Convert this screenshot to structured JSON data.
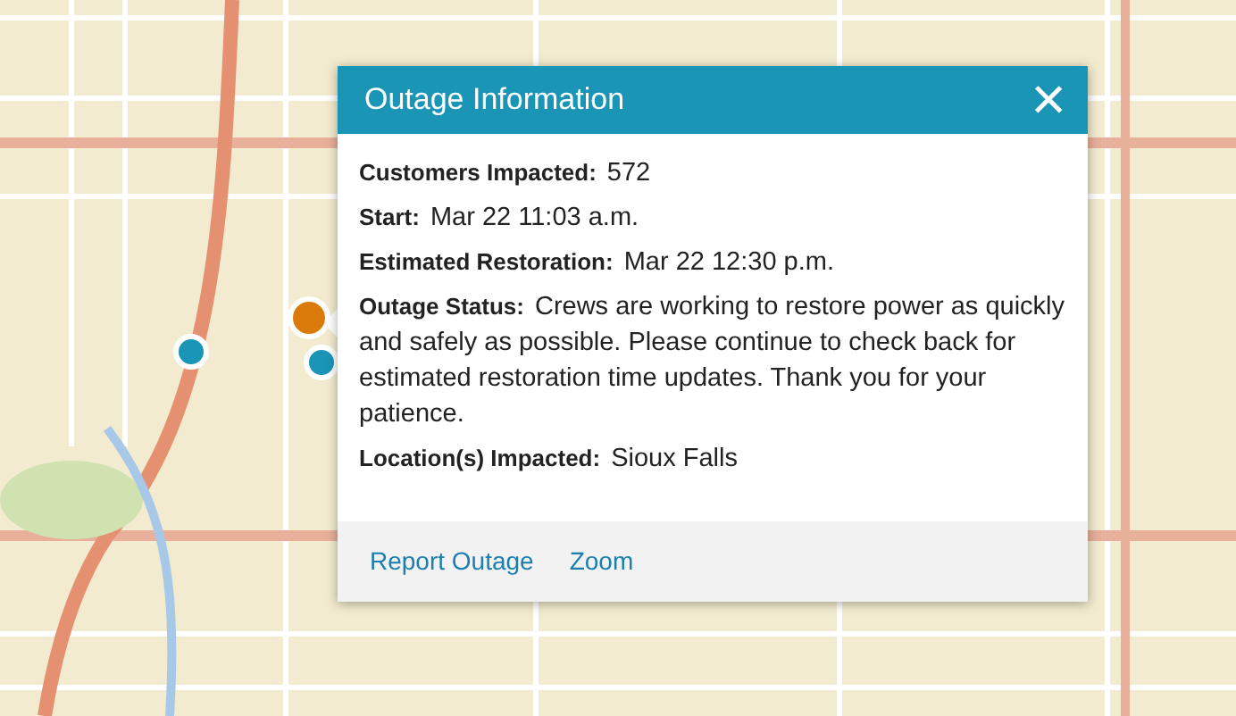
{
  "map": {
    "markers": [
      {
        "color": "#d97a0a"
      },
      {
        "color": "#1a95b8"
      },
      {
        "color": "#1a95b8"
      }
    ]
  },
  "popup": {
    "title": "Outage Information",
    "close": "×",
    "fields": [
      {
        "label": "Customers Impacted:",
        "value": "572"
      },
      {
        "label": "Start:",
        "value": "Mar 22 11:03 a.m."
      },
      {
        "label": "Estimated Restoration:",
        "value": "Mar 22 12:30 p.m."
      },
      {
        "label": "Outage Status:",
        "value": "Crews are working to restore power as quickly and safely as possible. Please continue to check back for estimated restoration time updates. Thank you for your patience."
      },
      {
        "label": "Location(s) Impacted:",
        "value": "Sioux Falls"
      }
    ],
    "actions": [
      "Report Outage",
      "Zoom"
    ]
  }
}
